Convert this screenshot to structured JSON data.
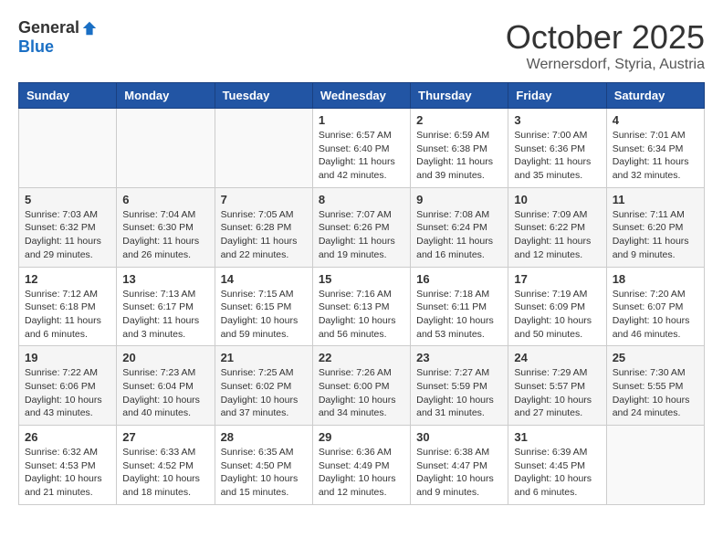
{
  "header": {
    "logo_general": "General",
    "logo_blue": "Blue",
    "month_title": "October 2025",
    "subtitle": "Wernersdorf, Styria, Austria"
  },
  "weekdays": [
    "Sunday",
    "Monday",
    "Tuesday",
    "Wednesday",
    "Thursday",
    "Friday",
    "Saturday"
  ],
  "weeks": [
    [
      {
        "day": "",
        "info": ""
      },
      {
        "day": "",
        "info": ""
      },
      {
        "day": "",
        "info": ""
      },
      {
        "day": "1",
        "info": "Sunrise: 6:57 AM\nSunset: 6:40 PM\nDaylight: 11 hours\nand 42 minutes."
      },
      {
        "day": "2",
        "info": "Sunrise: 6:59 AM\nSunset: 6:38 PM\nDaylight: 11 hours\nand 39 minutes."
      },
      {
        "day": "3",
        "info": "Sunrise: 7:00 AM\nSunset: 6:36 PM\nDaylight: 11 hours\nand 35 minutes."
      },
      {
        "day": "4",
        "info": "Sunrise: 7:01 AM\nSunset: 6:34 PM\nDaylight: 11 hours\nand 32 minutes."
      }
    ],
    [
      {
        "day": "5",
        "info": "Sunrise: 7:03 AM\nSunset: 6:32 PM\nDaylight: 11 hours\nand 29 minutes."
      },
      {
        "day": "6",
        "info": "Sunrise: 7:04 AM\nSunset: 6:30 PM\nDaylight: 11 hours\nand 26 minutes."
      },
      {
        "day": "7",
        "info": "Sunrise: 7:05 AM\nSunset: 6:28 PM\nDaylight: 11 hours\nand 22 minutes."
      },
      {
        "day": "8",
        "info": "Sunrise: 7:07 AM\nSunset: 6:26 PM\nDaylight: 11 hours\nand 19 minutes."
      },
      {
        "day": "9",
        "info": "Sunrise: 7:08 AM\nSunset: 6:24 PM\nDaylight: 11 hours\nand 16 minutes."
      },
      {
        "day": "10",
        "info": "Sunrise: 7:09 AM\nSunset: 6:22 PM\nDaylight: 11 hours\nand 12 minutes."
      },
      {
        "day": "11",
        "info": "Sunrise: 7:11 AM\nSunset: 6:20 PM\nDaylight: 11 hours\nand 9 minutes."
      }
    ],
    [
      {
        "day": "12",
        "info": "Sunrise: 7:12 AM\nSunset: 6:18 PM\nDaylight: 11 hours\nand 6 minutes."
      },
      {
        "day": "13",
        "info": "Sunrise: 7:13 AM\nSunset: 6:17 PM\nDaylight: 11 hours\nand 3 minutes."
      },
      {
        "day": "14",
        "info": "Sunrise: 7:15 AM\nSunset: 6:15 PM\nDaylight: 10 hours\nand 59 minutes."
      },
      {
        "day": "15",
        "info": "Sunrise: 7:16 AM\nSunset: 6:13 PM\nDaylight: 10 hours\nand 56 minutes."
      },
      {
        "day": "16",
        "info": "Sunrise: 7:18 AM\nSunset: 6:11 PM\nDaylight: 10 hours\nand 53 minutes."
      },
      {
        "day": "17",
        "info": "Sunrise: 7:19 AM\nSunset: 6:09 PM\nDaylight: 10 hours\nand 50 minutes."
      },
      {
        "day": "18",
        "info": "Sunrise: 7:20 AM\nSunset: 6:07 PM\nDaylight: 10 hours\nand 46 minutes."
      }
    ],
    [
      {
        "day": "19",
        "info": "Sunrise: 7:22 AM\nSunset: 6:06 PM\nDaylight: 10 hours\nand 43 minutes."
      },
      {
        "day": "20",
        "info": "Sunrise: 7:23 AM\nSunset: 6:04 PM\nDaylight: 10 hours\nand 40 minutes."
      },
      {
        "day": "21",
        "info": "Sunrise: 7:25 AM\nSunset: 6:02 PM\nDaylight: 10 hours\nand 37 minutes."
      },
      {
        "day": "22",
        "info": "Sunrise: 7:26 AM\nSunset: 6:00 PM\nDaylight: 10 hours\nand 34 minutes."
      },
      {
        "day": "23",
        "info": "Sunrise: 7:27 AM\nSunset: 5:59 PM\nDaylight: 10 hours\nand 31 minutes."
      },
      {
        "day": "24",
        "info": "Sunrise: 7:29 AM\nSunset: 5:57 PM\nDaylight: 10 hours\nand 27 minutes."
      },
      {
        "day": "25",
        "info": "Sunrise: 7:30 AM\nSunset: 5:55 PM\nDaylight: 10 hours\nand 24 minutes."
      }
    ],
    [
      {
        "day": "26",
        "info": "Sunrise: 6:32 AM\nSunset: 4:53 PM\nDaylight: 10 hours\nand 21 minutes."
      },
      {
        "day": "27",
        "info": "Sunrise: 6:33 AM\nSunset: 4:52 PM\nDaylight: 10 hours\nand 18 minutes."
      },
      {
        "day": "28",
        "info": "Sunrise: 6:35 AM\nSunset: 4:50 PM\nDaylight: 10 hours\nand 15 minutes."
      },
      {
        "day": "29",
        "info": "Sunrise: 6:36 AM\nSunset: 4:49 PM\nDaylight: 10 hours\nand 12 minutes."
      },
      {
        "day": "30",
        "info": "Sunrise: 6:38 AM\nSunset: 4:47 PM\nDaylight: 10 hours\nand 9 minutes."
      },
      {
        "day": "31",
        "info": "Sunrise: 6:39 AM\nSunset: 4:45 PM\nDaylight: 10 hours\nand 6 minutes."
      },
      {
        "day": "",
        "info": ""
      }
    ]
  ]
}
